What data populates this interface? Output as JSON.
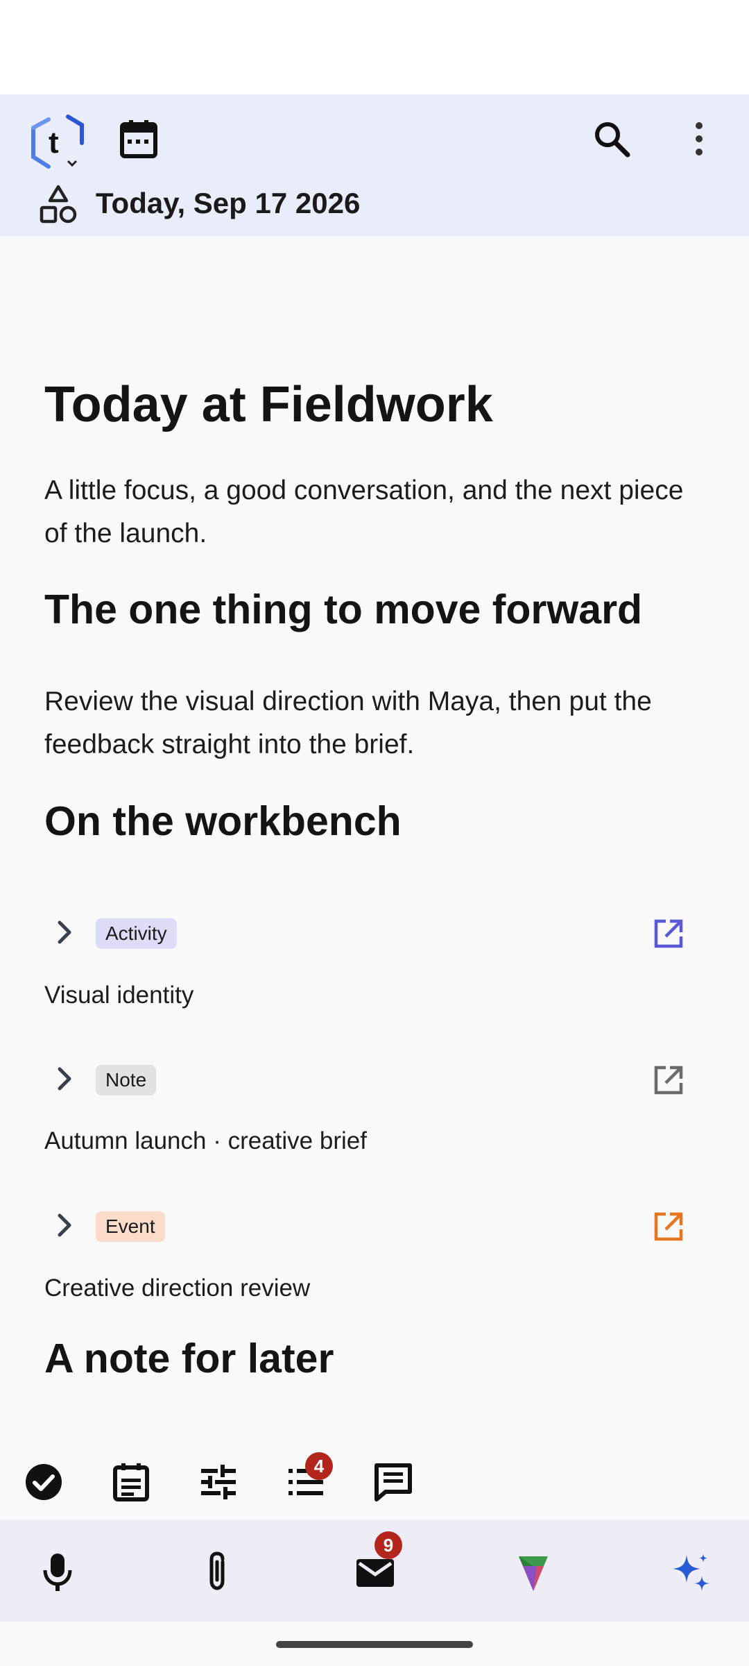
{
  "header": {
    "logo_letter": "t",
    "date_label": "Today, Sep 17 2026"
  },
  "main": {
    "title": "Today at Fieldwork",
    "intro": "A little focus, a good conversation, and the next piece of the launch.",
    "section1_heading": "The one thing to move forward",
    "section1_body": "Review the visual direction with Maya, then put the feedback straight into the brief.",
    "section2_heading": "On the workbench",
    "items": [
      {
        "tag": "Activity",
        "title": "Visual identity",
        "tag_bg": "#dcdcf6",
        "accent": "#5a58d6"
      },
      {
        "tag": "Note",
        "title": "Autumn launch · creative brief",
        "tag_bg": "#e2e2e4",
        "accent": "#6b6b6b"
      },
      {
        "tag": "Event",
        "title": "Creative direction review",
        "tag_bg": "#fbdccb",
        "accent": "#e8751f"
      }
    ],
    "section3_heading": "A note for later"
  },
  "toolbar": {
    "tasks_badge": "4",
    "icons": [
      "check-circle-icon",
      "note-icon",
      "tune-icon",
      "checklist-icon",
      "comment-icon"
    ]
  },
  "bottom_bar": {
    "mail_badge": "9",
    "icons": [
      "microphone-icon",
      "paperclip-icon",
      "mail-icon",
      "gem-icon",
      "sparkle-icon"
    ],
    "accent": "#2a5bd7"
  }
}
